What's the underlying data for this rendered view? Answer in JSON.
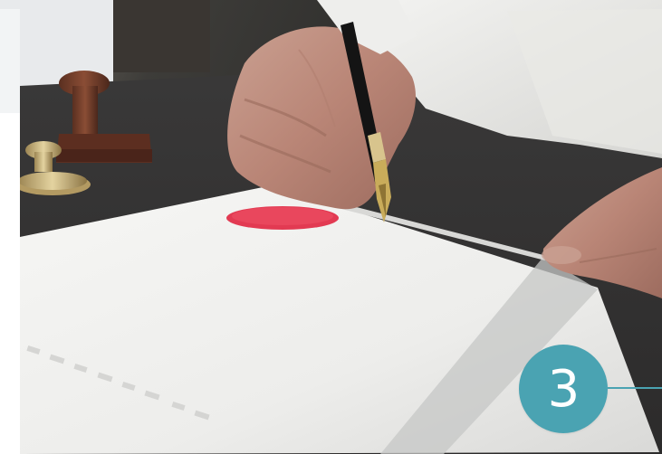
{
  "step_badge": {
    "number": "3",
    "color": "#4aa3b2"
  }
}
